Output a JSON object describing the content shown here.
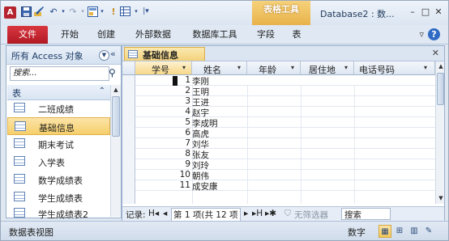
{
  "app_icon": "A",
  "context_tab": "表格工具",
  "window_title": "Database2 : 数...",
  "window_controls": [
    "–",
    "□",
    "✕"
  ],
  "ribbon_tabs": [
    "文件",
    "开始",
    "创建",
    "外部数据",
    "数据库工具",
    "字段",
    "表"
  ],
  "help_label": "?",
  "nav": {
    "header": "所有 Access 对象",
    "search_placeholder": "搜索...",
    "group": "表",
    "items": [
      "二班成绩",
      "基础信息",
      "期末考试",
      "入学表",
      "数学成绩表",
      "学生成绩表",
      "学生成绩表2"
    ],
    "selected_index": 1
  },
  "doc_tab": "基础信息",
  "columns": [
    "学号",
    "姓名",
    "年龄",
    "居住地",
    "电话号码"
  ],
  "rows": [
    {
      "id": "1",
      "name": "李刚"
    },
    {
      "id": "2",
      "name": "王明"
    },
    {
      "id": "3",
      "name": "王进"
    },
    {
      "id": "4",
      "name": "赵宇"
    },
    {
      "id": "5",
      "name": "李成明"
    },
    {
      "id": "6",
      "name": "高虎"
    },
    {
      "id": "7",
      "name": "刘华"
    },
    {
      "id": "8",
      "name": "张友"
    },
    {
      "id": "9",
      "name": "刘玲"
    },
    {
      "id": "10",
      "name": "朝伟"
    },
    {
      "id": "11",
      "name": "成安康"
    }
  ],
  "record_nav": {
    "label": "记录:",
    "first": "H◂",
    "prev": "◂",
    "position": "第 1 项(共 12 项",
    "next": "▸",
    "last": "▸H",
    "new": "▸✱",
    "filter": "无筛选器",
    "search": "搜索"
  },
  "status": {
    "left": "数据表视图",
    "right": "数字"
  }
}
